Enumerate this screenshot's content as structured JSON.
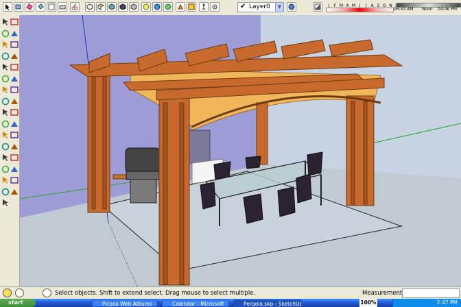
{
  "toolbar": {
    "layer": {
      "checked": true,
      "name": "Layer0"
    },
    "shadow": {
      "months": [
        "J",
        "F",
        "M",
        "A",
        "M",
        "J",
        "J",
        "A",
        "S",
        "O",
        "N",
        "D"
      ],
      "time_start": "06:43 AM",
      "time_mid": "Noon",
      "time_end": "04:46 PM"
    },
    "icons": [
      "select-icon",
      "make-component-icon",
      "eraser-icon",
      "paint-bucket-icon",
      "save-icon",
      "print-icon",
      "cut-icon",
      "copy-icon",
      "paste-icon",
      "erase-icon",
      "undo-icon",
      "redo-icon",
      "model-info-icon",
      "iso-view-icon",
      "top-view-icon",
      "front-view-icon",
      "right-view-icon",
      "back-view-icon",
      "left-view-icon",
      "xray-icon",
      "wireframe-icon",
      "hidden-line-icon",
      "shaded-icon",
      "textured-icon",
      "monochrome-icon",
      "section-plane-icon",
      "section-display-icon",
      "walk-icon",
      "look-around-icon",
      "layer-manager-icon",
      "shadow-toggle-icon"
    ]
  },
  "left_tools": [
    "select-tool-icon",
    "component-tool-icon",
    "paint-bucket-tool-icon",
    "eraser-tool-icon",
    "rectangle-tool-icon",
    "line-tool-icon",
    "circle-tool-icon",
    "arc-tool-icon",
    "polygon-tool-icon",
    "freehand-tool-icon",
    "move-tool-icon",
    "push-pull-tool-icon",
    "rotate-tool-icon",
    "follow-me-tool-icon",
    "scale-tool-icon",
    "offset-tool-icon",
    "tape-measure-tool-icon",
    "dimension-tool-icon",
    "protractor-tool-icon",
    "text-tool-icon",
    "axes-tool-icon",
    "3d-text-tool-icon",
    "orbit-tool-icon",
    "pan-tool-icon",
    "zoom-tool-icon",
    "zoom-window-tool-icon",
    "zoom-extents-tool-icon",
    "previous-view-tool-icon",
    "position-camera-tool-icon",
    "walk-tool-icon",
    "look-around-tool-icon",
    "section-plane-tool-icon",
    "sandbox-tool-icon"
  ],
  "status": {
    "text": "Select objects. Shift to extend select. Drag mouse to select multiple.",
    "measurements_label": "Measurements",
    "measurements_value": ""
  },
  "taskbar": {
    "start": "start",
    "tasks": [
      {
        "label": "Picasa Web Albums -",
        "active": false
      },
      {
        "label": "Calendar - Microsoft",
        "active": false
      },
      {
        "label": "Pergola.skp - SketchUp",
        "active": true
      }
    ],
    "zoom": "100%",
    "clock": "2:47 PM"
  },
  "colors": {
    "sky": "#c7d3e3",
    "ground": "#bfcad3",
    "wall": "#9e9cd6",
    "wood": "#c86a2e",
    "wood_dark": "#8b4515",
    "canopy": "#f2b65a",
    "chair": "#2b2430"
  }
}
